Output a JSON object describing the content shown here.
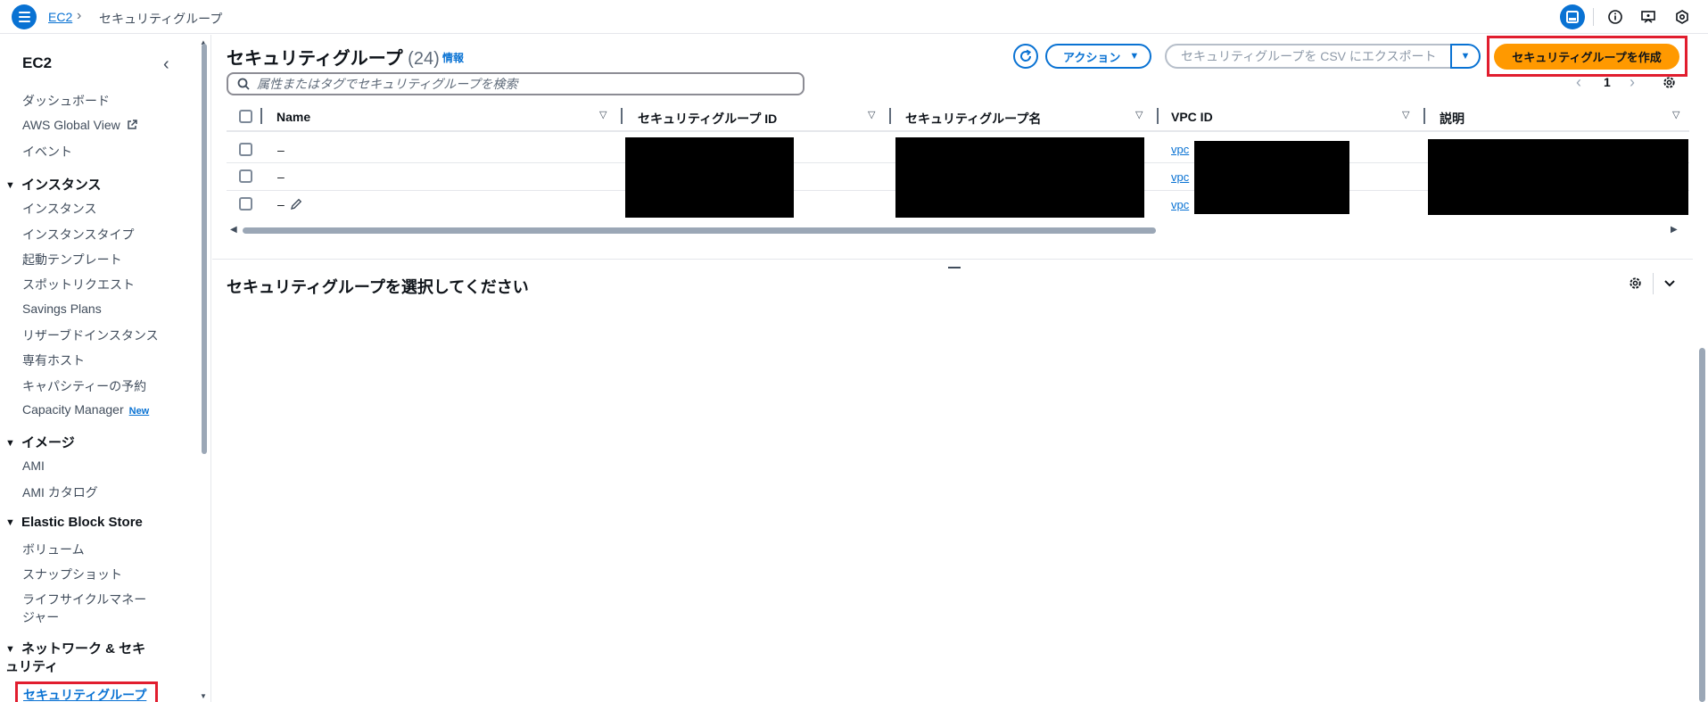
{
  "breadcrumb": {
    "root": "EC2",
    "separator": "›",
    "current": "セキュリティグループ"
  },
  "sidebar": {
    "title": "EC2",
    "top_items": [
      "ダッシュボード",
      "AWS Global View",
      "イベント"
    ],
    "sections": [
      {
        "label": "インスタンス",
        "items": [
          "インスタンス",
          "インスタンスタイプ",
          "起動テンプレート",
          "スポットリクエスト",
          "Savings Plans",
          "リザーブドインスタンス",
          "専有ホスト",
          "キャパシティーの予約",
          "Capacity Manager"
        ]
      },
      {
        "label": "イメージ",
        "items": [
          "AMI",
          "AMI カタログ"
        ]
      },
      {
        "label": "Elastic Block Store",
        "items": [
          "ボリューム",
          "スナップショット",
          "ライフサイクルマネージャー"
        ]
      },
      {
        "label": "ネットワーク & セキュリティ",
        "items": [
          "セキュリティグループ"
        ]
      }
    ],
    "new_badge": "New",
    "active_item": "セキュリティグループ"
  },
  "header": {
    "title": "セキュリティグループ",
    "count": "(24)",
    "info": "情報",
    "actions_label": "アクション",
    "export_label": "セキュリティグループを CSV にエクスポート",
    "create_label": "セキュリティグループを作成"
  },
  "search": {
    "placeholder": "属性またはタグでセキュリティグループを検索"
  },
  "pagination": {
    "page": "1"
  },
  "table": {
    "columns": [
      "Name",
      "セキュリティグループ ID",
      "セキュリティグループ名",
      "VPC ID",
      "説明"
    ],
    "rows": [
      {
        "name": "–",
        "vpc": "vpc"
      },
      {
        "name": "–",
        "vpc": "vpc"
      },
      {
        "name": "–",
        "vpc": "vpc"
      }
    ]
  },
  "detail": {
    "title": "セキュリティグループを選択してください"
  },
  "colors": {
    "accent": "#0972d3",
    "primary_button": "#ff9900",
    "highlight": "#e11d2e"
  }
}
